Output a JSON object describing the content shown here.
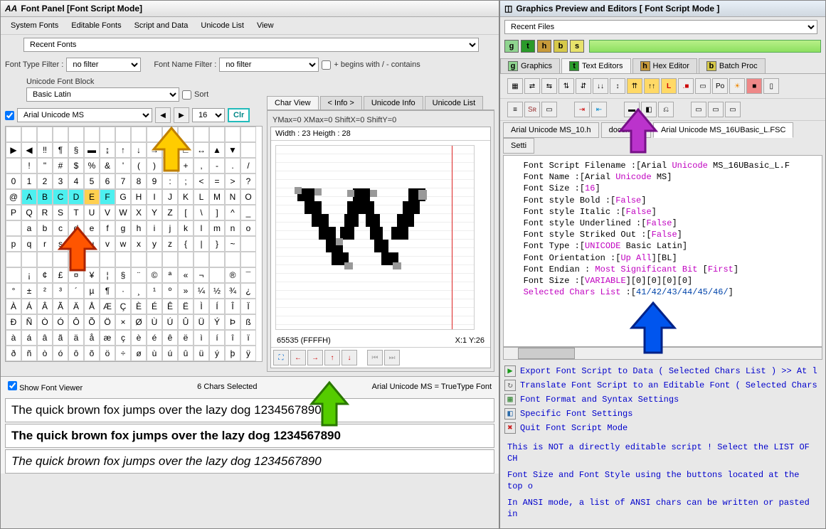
{
  "left": {
    "title": "Font Panel [Font Script Mode]",
    "menus": [
      "System Fonts",
      "Editable Fonts",
      "Script and Data",
      "Unicode List",
      "View"
    ],
    "recent": "Recent Fonts",
    "filter_type_label": "Font Type Filter :",
    "filter_type": "no filter",
    "filter_name_label": "Font Name Filter :",
    "filter_name": "no filter",
    "begins_label": "+ begins with / - contains",
    "block_label": "Unicode Font Block",
    "block": "Basic Latin",
    "sort": "Sort",
    "font": "Arial Unicode MS",
    "size": "16",
    "clr": "Clr",
    "charview_tabs": [
      "Char View",
      "< Info >",
      "Unicode Info",
      "Unicode List"
    ],
    "ymax": "YMax=0  XMax=0  ShiftX=0  ShiftY=0",
    "wh": "Width : 23  Heigth : 28",
    "hex": "65535  (FFFFH)",
    "xy": "X:1 Y:26",
    "show_viewer": "Show Font Viewer",
    "chars_selected": "6 Chars Selected",
    "tt": "Arial Unicode MS = TrueType Font",
    "sample": "The quick brown fox jumps over the lazy dog 1234567890",
    "gridrows": [
      [
        "",
        "",
        "",
        "",
        "",
        "",
        "",
        "",
        "",
        "",
        "",
        "",
        "",
        "",
        "",
        ""
      ],
      [
        "▶",
        "◀",
        "‼",
        "¶",
        "§",
        "▬",
        "↨",
        "↑",
        "↓",
        "→",
        "←",
        "∟",
        "↔",
        "▲",
        "▼",
        ""
      ],
      [
        "",
        "!",
        "\"",
        "#",
        "$",
        "%",
        "&",
        "'",
        "(",
        ")",
        "*",
        "+",
        ",",
        "-",
        ".",
        "/"
      ],
      [
        "0",
        "1",
        "2",
        "3",
        "4",
        "5",
        "6",
        "7",
        "8",
        "9",
        ":",
        ";",
        "<",
        "=",
        ">",
        "?"
      ],
      [
        "@",
        "A",
        "B",
        "C",
        "D",
        "E",
        "F",
        "G",
        "H",
        "I",
        "J",
        "K",
        "L",
        "M",
        "N",
        "O"
      ],
      [
        "P",
        "Q",
        "R",
        "S",
        "T",
        "U",
        "V",
        "W",
        "X",
        "Y",
        "Z",
        "[",
        "\\",
        "]",
        "^",
        "_"
      ],
      [
        "",
        "a",
        "b",
        "c",
        "d",
        "e",
        "f",
        "g",
        "h",
        "i",
        "j",
        "k",
        "l",
        "m",
        "n",
        "o"
      ],
      [
        "p",
        "q",
        "r",
        "s",
        "t",
        "u",
        "v",
        "w",
        "x",
        "y",
        "z",
        "{",
        "|",
        "}",
        "~",
        ""
      ],
      [
        "",
        "",
        "",
        "",
        "",
        "",
        "",
        "",
        "",
        "",
        "",
        "",
        "",
        "",
        "",
        ""
      ],
      [
        "",
        "¡",
        "¢",
        "£",
        "¤",
        "¥",
        "¦",
        "§",
        "¨",
        "©",
        "ª",
        "«",
        "¬",
        "­",
        "®",
        "¯"
      ],
      [
        "°",
        "±",
        "²",
        "³",
        "´",
        "µ",
        "¶",
        "·",
        "¸",
        "¹",
        "º",
        "»",
        "¼",
        "½",
        "¾",
        "¿"
      ],
      [
        "À",
        "Á",
        "Â",
        "Ã",
        "Ä",
        "Å",
        "Æ",
        "Ç",
        "È",
        "É",
        "Ê",
        "Ë",
        "Ì",
        "Í",
        "Î",
        "Ï"
      ],
      [
        "Ð",
        "Ñ",
        "Ò",
        "Ó",
        "Ô",
        "Õ",
        "Ö",
        "×",
        "Ø",
        "Ù",
        "Ú",
        "Û",
        "Ü",
        "Ý",
        "Þ",
        "ß"
      ],
      [
        "à",
        "á",
        "â",
        "ã",
        "ä",
        "å",
        "æ",
        "ç",
        "è",
        "é",
        "ê",
        "ë",
        "ì",
        "í",
        "î",
        "ï"
      ],
      [
        "ð",
        "ñ",
        "ò",
        "ó",
        "ô",
        "õ",
        "ö",
        "÷",
        "ø",
        "ù",
        "ú",
        "û",
        "ü",
        "ý",
        "þ",
        "ÿ"
      ]
    ]
  },
  "right": {
    "title": "Graphics Preview and Editors [ Font Script Mode ]",
    "recent": "Recent Files",
    "colorbtns": [
      "g",
      "t",
      "h",
      "b",
      "s"
    ],
    "colors": [
      "#8fd48f",
      "#2a9a2a",
      "#c79a3a",
      "#d6c94a",
      "#e7e26b"
    ],
    "tabs": [
      {
        "icon": "g",
        "label": "Graphics"
      },
      {
        "icon": "t",
        "label": "Text Editors"
      },
      {
        "icon": "h",
        "label": "Hex Editor"
      },
      {
        "icon": "b",
        "label": "Batch Proc"
      }
    ],
    "filetabs": [
      "Arial Unicode MS_10.h",
      "document",
      "Arial Unicode MS_16UBasic_L.FSC",
      "Setti"
    ],
    "code_lines": [
      [
        "Font Script Filename :[Arial ",
        "Unicode",
        " MS_16UBasic_L.F"
      ],
      [
        "Font Name :[Arial ",
        "Unicode",
        " MS]"
      ],
      [
        "Font Size :[",
        "16",
        "]"
      ],
      [
        "Font style Bold :[",
        "False",
        "]"
      ],
      [
        "Font style Italic :[",
        "False",
        "]"
      ],
      [
        "Font style Underlined :[",
        "False",
        "]"
      ],
      [
        "Font style Striked Out :[",
        "False",
        "]"
      ],
      [
        "Font Type :[",
        "UNICODE",
        " Basic Latin]"
      ],
      [
        "Font Orientation :[",
        "Up All",
        "][BL]"
      ],
      [
        "Font Endian : ",
        "Most Significant Bit",
        " [",
        "First",
        "]"
      ],
      [
        "Font Size :[",
        "VARIABLE",
        "][0][0][0][0]"
      ],
      [
        "Selected Chars List",
        " :[",
        "41/42/43/44/45/46/",
        "]"
      ]
    ],
    "links": [
      {
        "color": "#1a9a1a",
        "text": "Export Font Script to Data  ( Selected Chars List ) >> At l"
      },
      {
        "color": "#666",
        "text": "Translate Font Script to an Editable Font ( Selected Chars"
      },
      {
        "color": "#3a8a3a",
        "text": "Font Format and Syntax Settings"
      },
      {
        "color": "#2a6aaa",
        "text": "Specific Font Settings"
      },
      {
        "color": "#cc2222",
        "text": "Quit Font Script Mode"
      }
    ],
    "note1": "This is NOT a directly editable script ! Select the LIST OF CH",
    "note2": "Font Size and Font Style using the buttons located at the top o",
    "note3": "In ANSI mode, a list of ANSI chars can be written or pasted in"
  }
}
